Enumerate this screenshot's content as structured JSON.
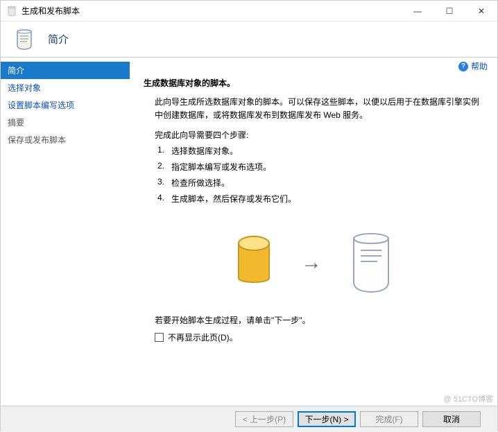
{
  "window": {
    "title": "生成和发布脚本"
  },
  "header": {
    "page_title": "简介"
  },
  "sidebar": {
    "items": [
      {
        "label": "简介"
      },
      {
        "label": "选择对象"
      },
      {
        "label": "设置脚本编写选项"
      },
      {
        "label": "摘要"
      },
      {
        "label": "保存或发布脚本"
      }
    ]
  },
  "content": {
    "help_label": "帮助",
    "heading": "生成数据库对象的脚本。",
    "description": "此向导生成所选数据库对象的脚本。可以保存这些脚本，以便以后用于在数据库引擎实例中创建数据库，或将数据库发布到数据库发布 Web 服务。",
    "steps_intro": "完成此向导需要四个步骤:",
    "steps": [
      "选择数据库对象。",
      "指定脚本编写或发布选项。",
      "检查所做选择。",
      "生成脚本，然后保存或发布它们。"
    ],
    "footer_text": "若要开始脚本生成过程，请单击\"下一步\"。",
    "checkbox_label": "不再显示此页(D)。"
  },
  "buttons": {
    "prev": "< 上一步(P)",
    "next": "下一步(N) >",
    "finish": "完成(F)",
    "cancel": "取消"
  },
  "watermark": "@ 51CTO博客"
}
